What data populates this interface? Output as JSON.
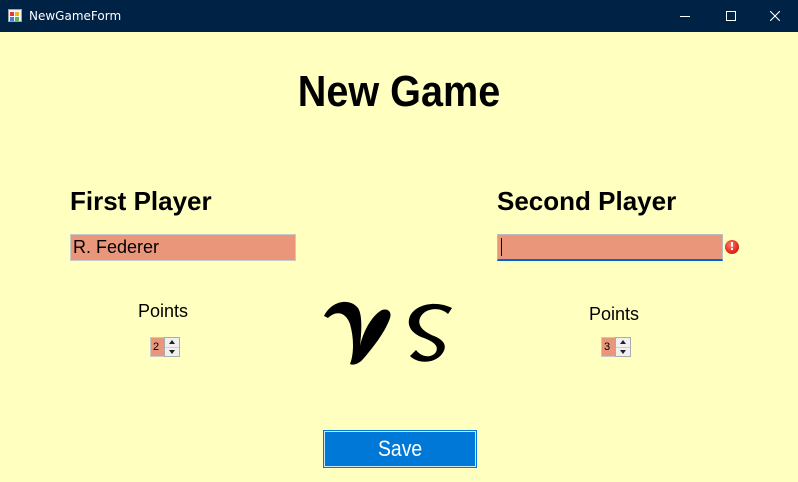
{
  "window": {
    "title": "NewGameForm",
    "icon": "form-app-icon",
    "controls": [
      "minimize-icon",
      "maximize-icon",
      "close-icon"
    ]
  },
  "form": {
    "heading": "New Game",
    "first_player": {
      "label": "First Player",
      "name_value": "R. Federer",
      "points_label": "Points",
      "points_value": "2"
    },
    "second_player": {
      "label": "Second Player",
      "name_value": "",
      "has_error": true,
      "error_icon": "error-icon",
      "points_label": "Points",
      "points_value": "3"
    },
    "versus_text": "VS",
    "save_label": "Save"
  },
  "colors": {
    "form_background": "#ffffc0",
    "titlebar": "#002245",
    "input_background": "#ea967a",
    "save_button": "#0078d7",
    "error": "#e02a1a"
  }
}
